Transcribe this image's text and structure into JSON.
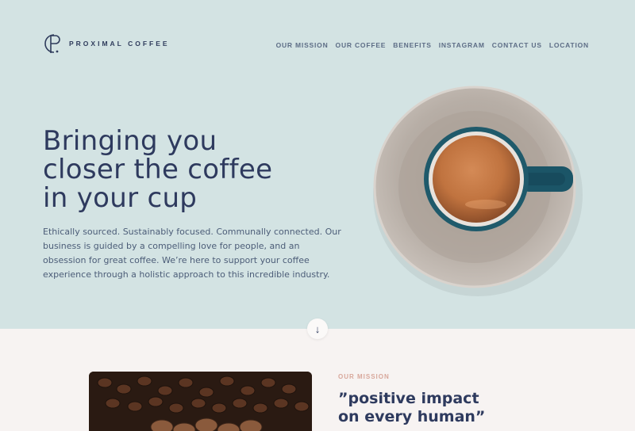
{
  "brand": {
    "name": "PROXIMAL COFFEE",
    "logo_icon": "cp-monogram-icon"
  },
  "nav": {
    "items": [
      {
        "label": "OUR MISSION"
      },
      {
        "label": "OUR COFFEE"
      },
      {
        "label": "BENEFITS"
      },
      {
        "label": "INSTAGRAM"
      },
      {
        "label": "CONTACT US"
      },
      {
        "label": "LOCATION"
      }
    ]
  },
  "hero": {
    "headline_lines": [
      "Bringing you",
      "closer the coffee",
      "in your cup"
    ],
    "lede": "Ethically sourced. Sustainably focused. Communally connected. Our business is guided by a compelling love for people, and an obsession for great coffee. We’re here to support your coffee experience through a holistic approach to this incredible industry.",
    "scroll_icon": "↓"
  },
  "mission": {
    "label": "OUR MISSION",
    "quote_lines": [
      "”positive impact",
      "on every human”"
    ]
  },
  "colors": {
    "hero_bg": "#d3e3e3",
    "page_bg": "#f7f3f2",
    "navy": "#2e3a5e",
    "accent_pink": "#d8a79b",
    "cup_blue": "#1f5a6b",
    "saucer": "#b4aba2"
  }
}
